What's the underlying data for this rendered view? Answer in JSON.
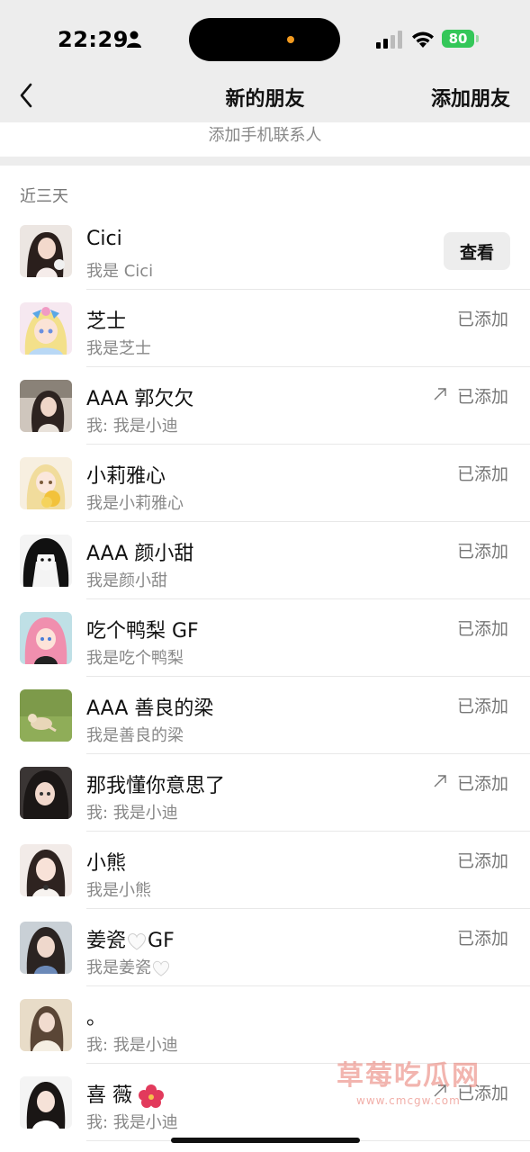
{
  "status_bar": {
    "time": "22:29",
    "battery": "80"
  },
  "nav": {
    "title": "新的朋友",
    "action": "添加朋友"
  },
  "phone_contacts_label": "添加手机联系人",
  "section_label": "近三天",
  "view_button": "查看",
  "friends": [
    {
      "name": "Cici",
      "message": "我是 Cici",
      "action": "查看"
    },
    {
      "name": "芝士",
      "message": "我是芝士",
      "status": "已添加"
    },
    {
      "name": "AAA 郭欠欠",
      "message": "我: 我是小迪",
      "status": "已添加"
    },
    {
      "name": "小莉雅心",
      "message": "我是小莉雅心",
      "status": "已添加"
    },
    {
      "name": "AAA 颜小甜",
      "message": "我是颜小甜",
      "status": "已添加"
    },
    {
      "name": "吃个鸭梨 GF",
      "message": "我是吃个鸭梨",
      "status": "已添加"
    },
    {
      "name": "AAA 善良的梁",
      "message": "我是善良的梁",
      "status": "已添加"
    },
    {
      "name": "那我懂你意思了",
      "message": "我: 我是小迪",
      "status": "已添加"
    },
    {
      "name": "小熊",
      "message": "我是小熊",
      "status": "已添加"
    },
    {
      "name_a": "姜瓷",
      "name_b": "GF",
      "message": "我是姜瓷",
      "status": "已添加"
    },
    {
      "name": "。",
      "message": "我: 我是小迪"
    },
    {
      "name": "喜 薇",
      "message": "我: 我是小迪",
      "status": "已添加"
    }
  ],
  "watermark": {
    "title": "草莓吃瓜网",
    "url": "www.cmcgw.com"
  }
}
